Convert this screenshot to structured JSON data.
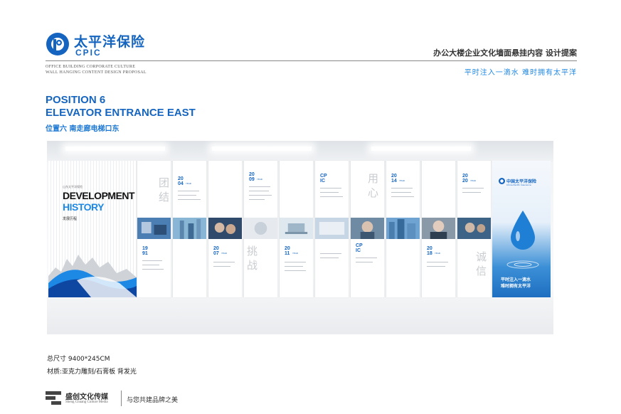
{
  "header": {
    "logo_cn": "太平洋保险",
    "logo_en": "CPIC",
    "doc_title": "办公大楼企业文化墙面悬挂内容 设计提案",
    "subtitle_en_1": "OFFICE BUILDING CORPORATE CULTURE",
    "subtitle_en_2": "WALL HANGING CONTENT DESIGN PROPOSAL",
    "slogan": "平时注入一滴水 难时拥有太平洋",
    "brand_color": "#1565c0"
  },
  "position": {
    "title_1": "POSITION 6",
    "title_2": "ELEVATOR ENTRANCE EAST",
    "title_cn": "位置六 南走廊电梯口东"
  },
  "wall": {
    "intro_small": "山东太平洋保险",
    "intro_title_1": "DEVELOPMENT",
    "intro_title_2": "HISTORY",
    "intro_cn": "发展历程",
    "years": [
      "19\n91",
      "20\n04",
      "20\n07",
      "20\n09",
      "20\n11",
      "CP\nIC",
      "CP\nIC",
      "20\n14",
      "20\n18",
      "20\n20"
    ],
    "year_suffix": "YEAR",
    "big_chars": [
      "团",
      "结",
      "挑",
      "战",
      "用",
      "心",
      "诚",
      "信"
    ],
    "brand_name": "中国太平洋保险",
    "brand_en": "China Pacific Insurance",
    "brand_slogan_1": "平时注入一滴水",
    "brand_slogan_2": "难时拥有太平洋"
  },
  "spec": {
    "size": "总尺寸  9400*245CM",
    "material": "材质:亚克力雕刻/石膏板  背发光"
  },
  "footer": {
    "company_cn": "盛创文化传媒",
    "company_en": "Sheng Chuang Culture Media",
    "slogan": "与您共建品牌之美"
  }
}
